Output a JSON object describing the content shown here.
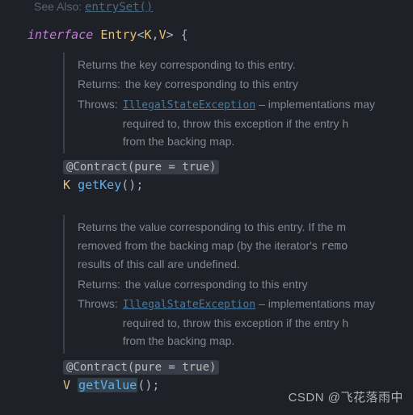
{
  "see_also": {
    "label": "See Also:",
    "link": "entrySet()"
  },
  "declaration": {
    "kw": "interface",
    "name": "Entry",
    "lt": "<",
    "p1": "K",
    "comma": ",",
    "p2": "V",
    "gt": ">",
    "brace": " {"
  },
  "doc1": {
    "summary": "Returns the key corresponding to this entry.",
    "returns_label": "Returns:",
    "returns_text": "the key corresponding to this entry",
    "throws_label": "Throws:",
    "throws_exception": "IllegalStateException",
    "throws_text1": " – implementations may",
    "throws_text2": "required to, throw this exception if the entry h",
    "throws_text3": "from the backing map."
  },
  "method1": {
    "annotation": "@Contract(pure = true)",
    "return_type": "K",
    "name": "getKey",
    "parens": "()",
    "semi": ";"
  },
  "doc2": {
    "summary1": "Returns the value corresponding to this entry. If the m",
    "summary2a": "removed from the backing map (by the iterator's ",
    "summary2b": "remo",
    "summary3": "results of this call are undefined.",
    "returns_label": "Returns:",
    "returns_text": "the value corresponding to this entry",
    "throws_label": "Throws:",
    "throws_exception": "IllegalStateException",
    "throws_text1": " – implementations may",
    "throws_text2": "required to, throw this exception if the entry h",
    "throws_text3": "from the backing map."
  },
  "method2": {
    "annotation": "@Contract(pure = true)",
    "return_type": "V",
    "name": "getValue",
    "parens": "()",
    "semi": ";"
  },
  "watermark": "CSDN @飞花落雨中"
}
